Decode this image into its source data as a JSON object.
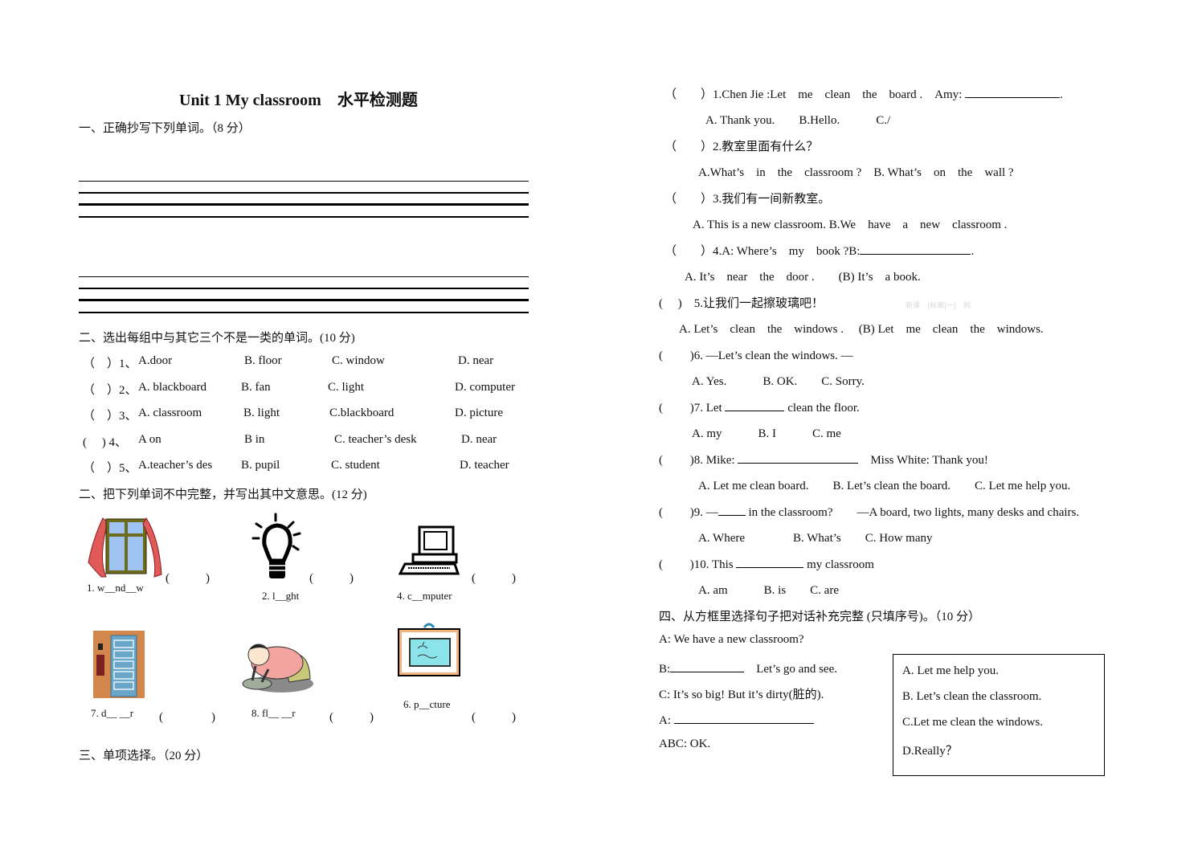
{
  "title": "Unit 1 My classroom　水平检测题",
  "section1": {
    "heading": "一、正确抄写下列单词。（8 分）"
  },
  "section2": {
    "heading": "二、选出每组中与其它三个不是一类的单词。(10 分)",
    "items": [
      {
        "num": "（　）1、",
        "a": "A.door",
        "b": "B. floor",
        "c": "C. window",
        "d": "D. near"
      },
      {
        "num": "（　）2、",
        "a": "A. blackboard",
        "b": "B. fan",
        "c": "C. light",
        "d": "D. computer"
      },
      {
        "num": "（　）3、",
        "a": "A. classroom",
        "b": "B. light",
        "c": "C.blackboard",
        "d": "D. picture"
      },
      {
        "num": "(　 ) 4、",
        "a": "A on",
        "b": "B in",
        "c": "C. teacher’s desk",
        "d": "D. near"
      },
      {
        "num": "（　）5、",
        "a": "A.teacher’s des",
        "b": "B. pupil",
        "c": "C. student",
        "d": "D. teacher"
      }
    ]
  },
  "section2b": {
    "heading": "二、把下列单词不中完整，并写出其中文意思。(12 分)",
    "pictures": [
      {
        "label": "1. w__nd__w",
        "icon": "window-icon",
        "paren": "(　　　)"
      },
      {
        "label": "2. l__ght",
        "icon": "light-bulb-icon",
        "paren": "(　　　)"
      },
      {
        "label": "4. c__mputer",
        "icon": "computer-icon",
        "paren": "(　　　)"
      },
      {
        "label": "7. d__ __r",
        "icon": "door-icon",
        "paren": "(　　　　)"
      },
      {
        "label": "8. fl__ __r",
        "icon": "floor-cleaning-icon",
        "paren": "(　　　)"
      },
      {
        "label": "6. p__cture",
        "icon": "picture-frame-icon",
        "paren": "(　　　)"
      }
    ]
  },
  "section3": {
    "heading": "三、单项选择。（20 分）",
    "questions": [
      {
        "stem": "（　　）1.Chen Jie :Let　me　clean　the　board .　Amy: ",
        "tail": ".",
        "options": "A. Thank you.　　B.Hello.　　　C./"
      },
      {
        "stem": "（　　）2.教室里面有什么？",
        "options": "A.What’s　in　the　classroom ?　B. What’s　on　the　wall ?"
      },
      {
        "stem": "（　　）3.我们有一间新教室。",
        "options": "A. This is a new classroom. B.We　have　a　new　classroom ."
      },
      {
        "stem": "（　　）4.A: Where’s　my　book ?B:",
        "tail": ".",
        "options": "A. It’s　near　the　door .　　(B) It’s　a book."
      },
      {
        "stem": "(　 )　5.让我们一起擦玻璃吧！",
        "options": "A. Let’s　clean　the　windows .　 (B) Let　me　clean　the　windows."
      },
      {
        "stem": "(　　 )6. —Let’s clean the windows. —",
        "options": "A. Yes.　　　B. OK.　　C. Sorry."
      },
      {
        "stem": "(　　 )7. Let ",
        "tail": " clean the floor.",
        "options": "A. my　　　B. I　　　C. me"
      },
      {
        "stem": "(　　 )8. Mike: ",
        "tail": "　Miss White: Thank you!",
        "options": "A. Let me clean board.　　B. Let’s clean the board.　　C. Let me help you."
      },
      {
        "stem": "(　　 )9. —",
        "tail": " in the classroom?　　—A board, two lights, many desks and chairs.",
        "options": "A. Where　　　　B. What’s　　C. How many"
      },
      {
        "stem": "(　　 )10. This ",
        "tail": " my classroom",
        "options": "A. am　　　B. is　　C. are"
      }
    ],
    "watermark": "新课　|标第|一|　网"
  },
  "section4": {
    "heading": "四、从方框里选择句子把对话补充完整 (只填序号)。（10 分）",
    "dialogue": [
      {
        "text": "A: We have a new classroom?"
      },
      {
        "prefix": "B:",
        "tail": "　Let’s go and see."
      },
      {
        "text": "C: It’s so big! But it’s dirty(脏的)."
      },
      {
        "prefix": "A: "
      },
      {
        "text": "ABC: OK."
      }
    ],
    "box_options": [
      "A. Let me help you.",
      "B. Let’s clean the classroom.",
      "C.Let me clean the windows.",
      "D.Really？"
    ]
  }
}
